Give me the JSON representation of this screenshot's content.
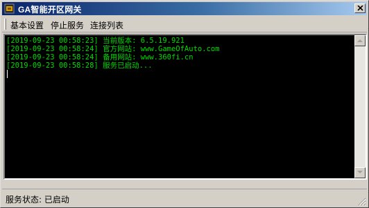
{
  "window": {
    "title": "GA智能开区网关",
    "icon": "app-icon"
  },
  "menu": {
    "items": [
      {
        "label": "基本设置"
      },
      {
        "label": "停止服务"
      },
      {
        "label": "连接列表"
      }
    ]
  },
  "log": {
    "lines": [
      "[2019-09-23 00:58:23] 当前版本: 6.5.19.921",
      "[2019-09-23 00:58:24] 官方网站: www.GameOfAuto.com",
      "[2019-09-23 00:58:24] 备用网站: www.360fi.cn",
      "[2019-09-23 00:58:28] 服务已启动..."
    ],
    "text_color": "#00d800",
    "background": "#000000"
  },
  "status": {
    "text": "服务状态: 已启动"
  },
  "colors": {
    "titlebar_start": "#0a246a",
    "titlebar_end": "#a6caf0",
    "face": "#d4d0c8"
  }
}
